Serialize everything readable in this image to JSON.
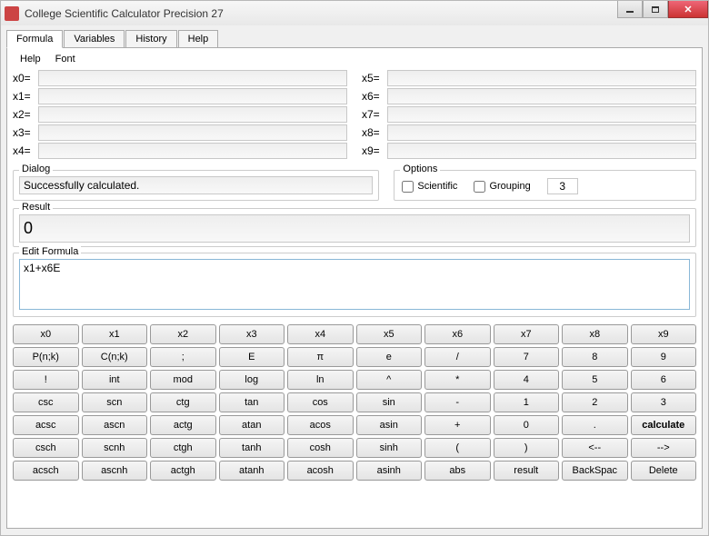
{
  "window": {
    "title": "College Scientific Calculator Precision 27"
  },
  "tabs": [
    {
      "label": "Formula",
      "active": true
    },
    {
      "label": "Variables",
      "active": false
    },
    {
      "label": "History",
      "active": false
    },
    {
      "label": "Help",
      "active": false
    }
  ],
  "menu": {
    "help": "Help",
    "font": "Font"
  },
  "vars": {
    "left": [
      {
        "label": "x0=",
        "value": ""
      },
      {
        "label": "x1=",
        "value": ""
      },
      {
        "label": "x2=",
        "value": ""
      },
      {
        "label": "x3=",
        "value": ""
      },
      {
        "label": "x4=",
        "value": ""
      }
    ],
    "right": [
      {
        "label": "x5=",
        "value": ""
      },
      {
        "label": "x6=",
        "value": ""
      },
      {
        "label": "x7=",
        "value": ""
      },
      {
        "label": "x8=",
        "value": ""
      },
      {
        "label": "x9=",
        "value": ""
      }
    ]
  },
  "dialog": {
    "legend": "Dialog",
    "text": "Successfully calculated."
  },
  "options": {
    "legend": "Options",
    "scientific_label": "Scientific",
    "scientific": false,
    "grouping_label": "Grouping",
    "grouping": false,
    "grouping_value": "3"
  },
  "result": {
    "legend": "Result",
    "value": "0"
  },
  "edit": {
    "legend": "Edit Formula",
    "value": "x1+x6E"
  },
  "keypad": [
    [
      "x0",
      "x1",
      "x2",
      "x3",
      "x4",
      "x5",
      "x6",
      "x7",
      "x8",
      "x9"
    ],
    [
      "P(n;k)",
      "C(n;k)",
      ";",
      "E",
      "π",
      "e",
      "/",
      "7",
      "8",
      "9"
    ],
    [
      "!",
      "int",
      "mod",
      "log",
      "ln",
      "^",
      "*",
      "4",
      "5",
      "6"
    ],
    [
      "csc",
      "scn",
      "ctg",
      "tan",
      "cos",
      "sin",
      "-",
      "1",
      "2",
      "3"
    ],
    [
      "acsc",
      "ascn",
      "actg",
      "atan",
      "acos",
      "asin",
      "+",
      "0",
      ".",
      "calculate"
    ],
    [
      "csch",
      "scnh",
      "ctgh",
      "tanh",
      "cosh",
      "sinh",
      "(",
      ")",
      "<--",
      "-->"
    ],
    [
      "acsch",
      "ascnh",
      "actgh",
      "atanh",
      "acosh",
      "asinh",
      "abs",
      "result",
      "BackSpac",
      "Delete"
    ]
  ]
}
